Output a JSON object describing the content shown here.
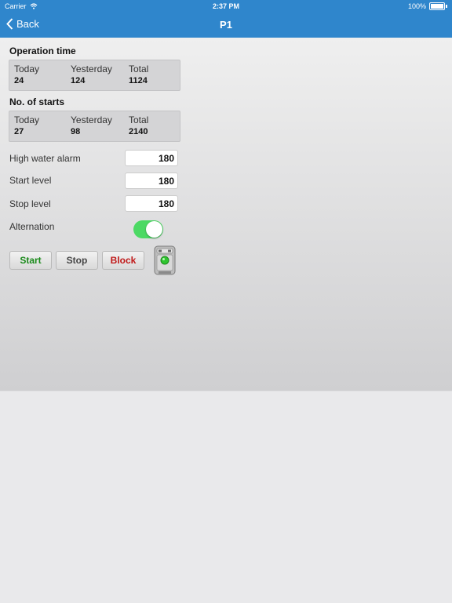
{
  "status": {
    "carrier": "Carrier",
    "time": "2:37 PM",
    "battery": "100%"
  },
  "nav": {
    "back_label": "Back",
    "title": "P1"
  },
  "operation_time": {
    "title": "Operation time",
    "stats": [
      {
        "label": "Today",
        "value": "24"
      },
      {
        "label": "Yesterday",
        "value": "124"
      },
      {
        "label": "Total",
        "value": "1124"
      }
    ]
  },
  "starts": {
    "title": "No. of starts",
    "stats": [
      {
        "label": "Today",
        "value": "27"
      },
      {
        "label": "Yesterday",
        "value": "98"
      },
      {
        "label": "Total",
        "value": "2140"
      }
    ]
  },
  "settings": {
    "high_water_alarm": {
      "label": "High water alarm",
      "value": "180"
    },
    "start_level": {
      "label": "Start level",
      "value": "180"
    },
    "stop_level": {
      "label": "Stop level",
      "value": "180"
    }
  },
  "alternation": {
    "label": "Alternation",
    "enabled": true
  },
  "buttons": {
    "start": {
      "label": "Start",
      "color": "#1a8a1a"
    },
    "stop": {
      "label": "Stop",
      "color": "#444444"
    },
    "block": {
      "label": "Block",
      "color": "#c01818"
    }
  },
  "pump": {
    "icon": "pump-icon",
    "status_color": "#2ec52e"
  },
  "colors": {
    "accent": "#2f86cc",
    "toggle_on": "#4cd964"
  }
}
